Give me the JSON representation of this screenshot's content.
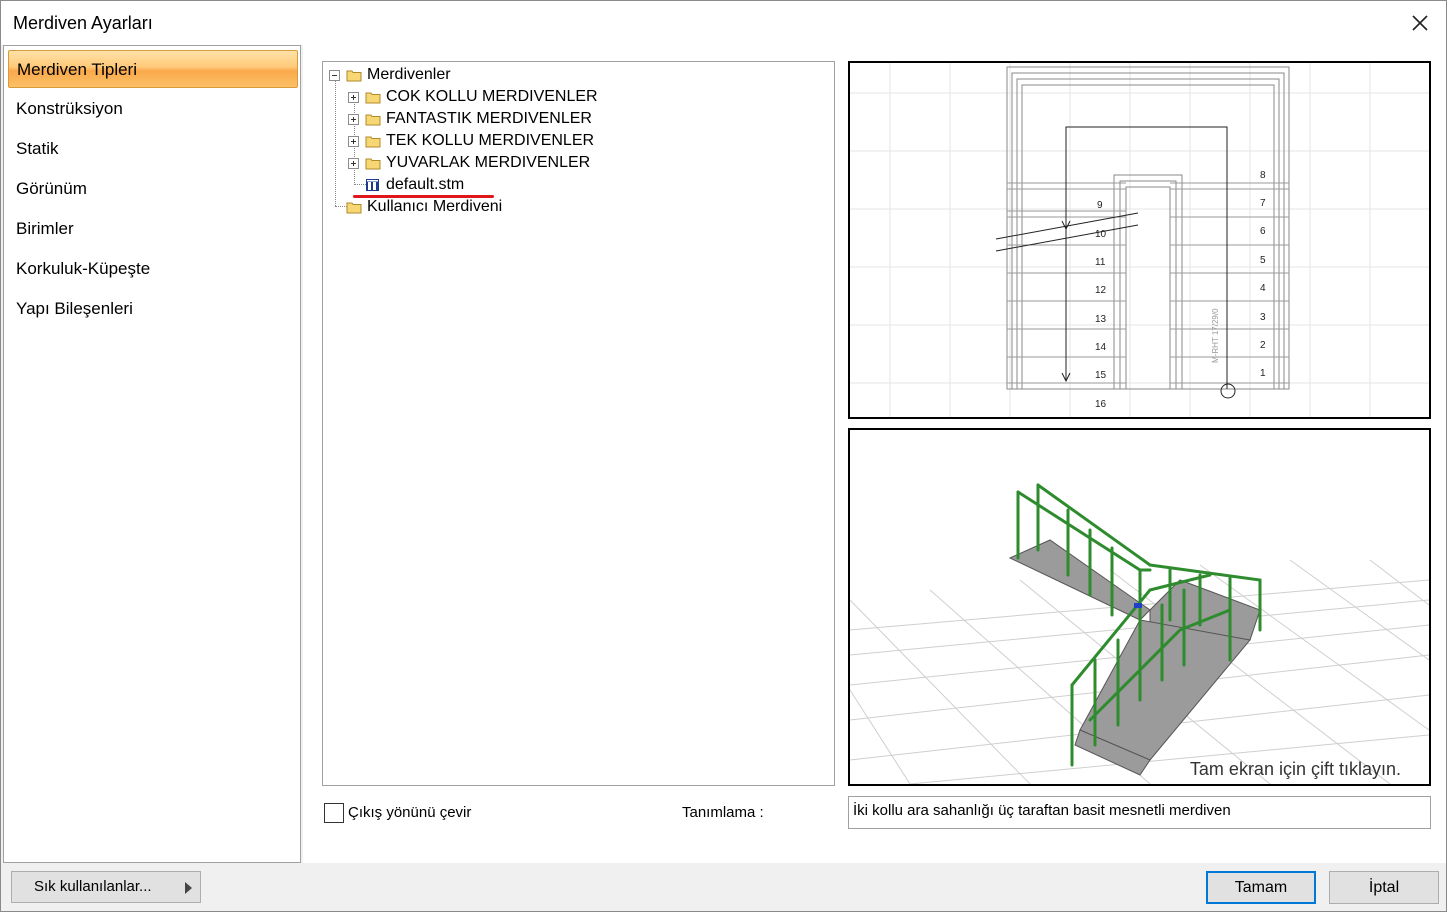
{
  "window": {
    "title": "Merdiven Ayarları"
  },
  "sidebar": {
    "items": [
      {
        "label": "Merdiven Tipleri",
        "active": true
      },
      {
        "label": "Konstrüksiyon"
      },
      {
        "label": "Statik"
      },
      {
        "label": "Görünüm"
      },
      {
        "label": "Birimler"
      },
      {
        "label": "Korkuluk-Küpeşte"
      },
      {
        "label": "Yapı Bileşenleri"
      }
    ]
  },
  "tree": {
    "root": "Merdivenler",
    "folders": [
      "COK KOLLU MERDIVENLER",
      "FANTASTIK MERDIVENLER",
      "TEK KOLLU MERDIVENLER",
      "YUVARLAK MERDIVENLER"
    ],
    "selected_file": "default.stm",
    "user_folder": "Kullanıcı Merdiveni"
  },
  "plan_preview": {
    "step_numbers_left": [
      "9",
      "10",
      "11",
      "12",
      "13",
      "14",
      "15",
      "16"
    ],
    "step_numbers_right": [
      "8",
      "7",
      "6",
      "5",
      "4",
      "3",
      "2",
      "1"
    ],
    "rotated_label": "M-RHT 17/29/0"
  },
  "preview3d": {
    "hint": "Tam ekran için çift tıklayın."
  },
  "options": {
    "flip_exit_label": "Çıkış yönünü çevir",
    "flip_exit_checked": false,
    "description_label": "Tanımlama :",
    "description_value": "İki kollu ara sahanlığı üç taraftan basit mesnetli merdiven"
  },
  "footer": {
    "frequent_label": "Sık kullanılanlar...",
    "ok_label": "Tamam",
    "cancel_label": "İptal"
  },
  "colors": {
    "accent": "#0078d7",
    "selection_underline": "#e0161b",
    "railing": "#2e8b2e"
  }
}
